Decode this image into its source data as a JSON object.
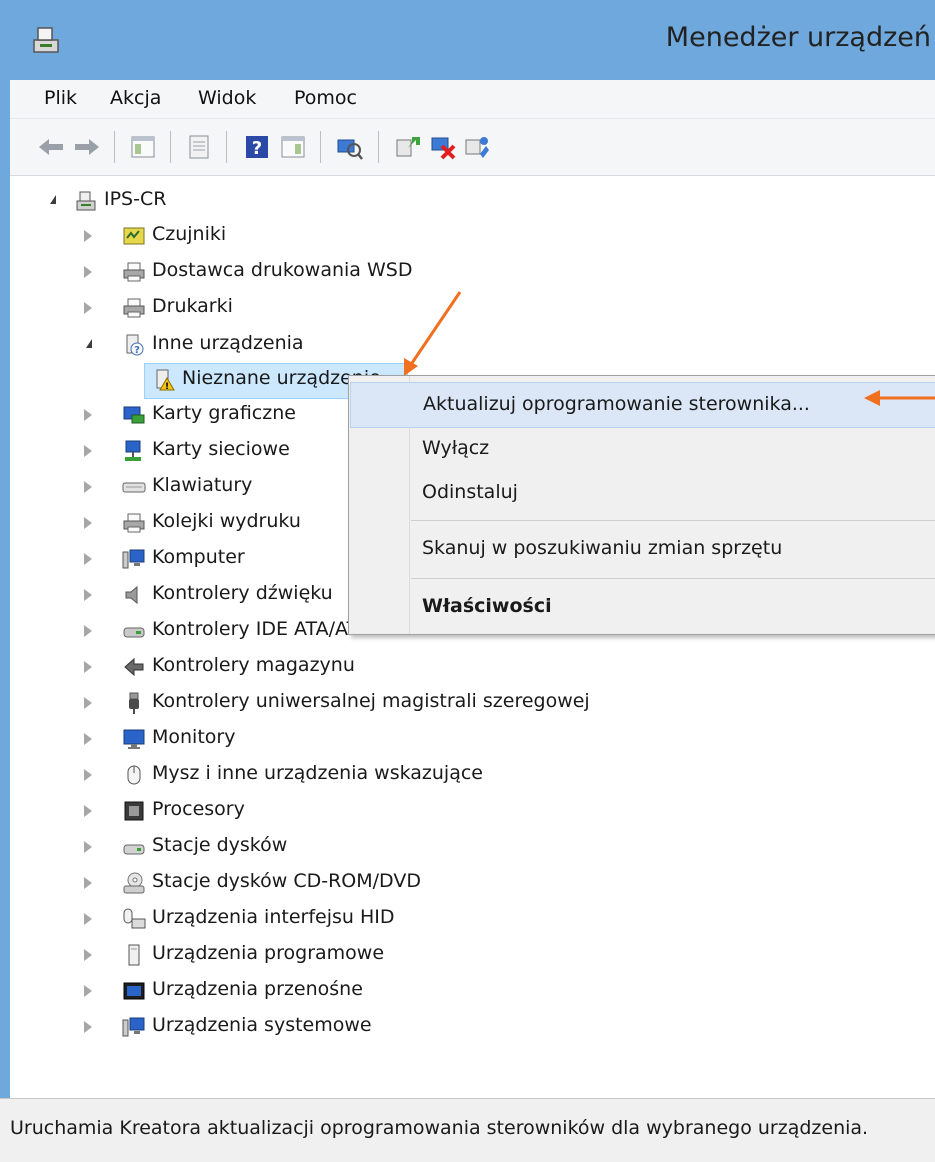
{
  "window": {
    "title": "Menedżer urządzeń"
  },
  "menubar": {
    "items": [
      "Plik",
      "Akcja",
      "Widok",
      "Pomoc"
    ]
  },
  "toolbar": {
    "buttons": [
      "back-icon",
      "forward-icon",
      "show-hide-console-tree-icon",
      "properties-icon",
      "help-icon",
      "action-pane-icon",
      "scan-hardware-icon",
      "update-driver-icon",
      "disable-device-icon",
      "uninstall-device-icon"
    ]
  },
  "tree": {
    "root": "IPS-CR",
    "categories": [
      {
        "label": "Czujniki",
        "icon": "sensor-icon"
      },
      {
        "label": "Dostawca drukowania WSD",
        "icon": "printer-icon"
      },
      {
        "label": "Drukarki",
        "icon": "printer-icon"
      },
      {
        "label": "Inne urządzenia",
        "icon": "unknown-device-icon",
        "expanded": true
      },
      {
        "label": "Karty graficzne",
        "icon": "display-adapter-icon"
      },
      {
        "label": "Karty sieciowe",
        "icon": "network-adapter-icon"
      },
      {
        "label": "Klawiatury",
        "icon": "keyboard-icon"
      },
      {
        "label": "Kolejki wydruku",
        "icon": "printer-icon"
      },
      {
        "label": "Komputer",
        "icon": "computer-icon"
      },
      {
        "label": "Kontrolery dźwięku",
        "icon": "speaker-icon"
      },
      {
        "label": "Kontrolery IDE ATA/ATAPI",
        "icon": "ide-controller-icon"
      },
      {
        "label": "Kontrolery magazynu",
        "icon": "storage-controller-icon"
      },
      {
        "label": "Kontrolery uniwersalnej magistrali szeregowej",
        "icon": "usb-icon"
      },
      {
        "label": "Monitory",
        "icon": "monitor-icon"
      },
      {
        "label": "Mysz i inne urządzenia wskazujące",
        "icon": "mouse-icon"
      },
      {
        "label": "Procesory",
        "icon": "processor-icon"
      },
      {
        "label": "Stacje dysków",
        "icon": "disk-drive-icon"
      },
      {
        "label": "Stacje dysków CD-ROM/DVD",
        "icon": "cdrom-icon"
      },
      {
        "label": "Urządzenia interfejsu HID",
        "icon": "hid-icon"
      },
      {
        "label": "Urządzenia programowe",
        "icon": "software-device-icon"
      },
      {
        "label": "Urządzenia przenośne",
        "icon": "portable-device-icon"
      },
      {
        "label": "Urządzenia systemowe",
        "icon": "system-device-icon"
      }
    ],
    "child_of_other": "Nieznane urządzenie"
  },
  "context_menu": {
    "update": "Aktualizuj oprogramowanie sterownika...",
    "disable": "Wyłącz",
    "uninstall": "Odinstaluj",
    "scan": "Skanuj w poszukiwaniu zmian sprzętu",
    "properties": "Właściwości"
  },
  "status": {
    "text": "Uruchamia Kreatora aktualizacji oprogramowania sterowników dla wybranego urządzenia."
  },
  "colors": {
    "accent_arrow": "#f07020",
    "titlebar": "#6fa8dc",
    "selection": "#cce8ff",
    "menu_hover": "#dbe7f6"
  }
}
